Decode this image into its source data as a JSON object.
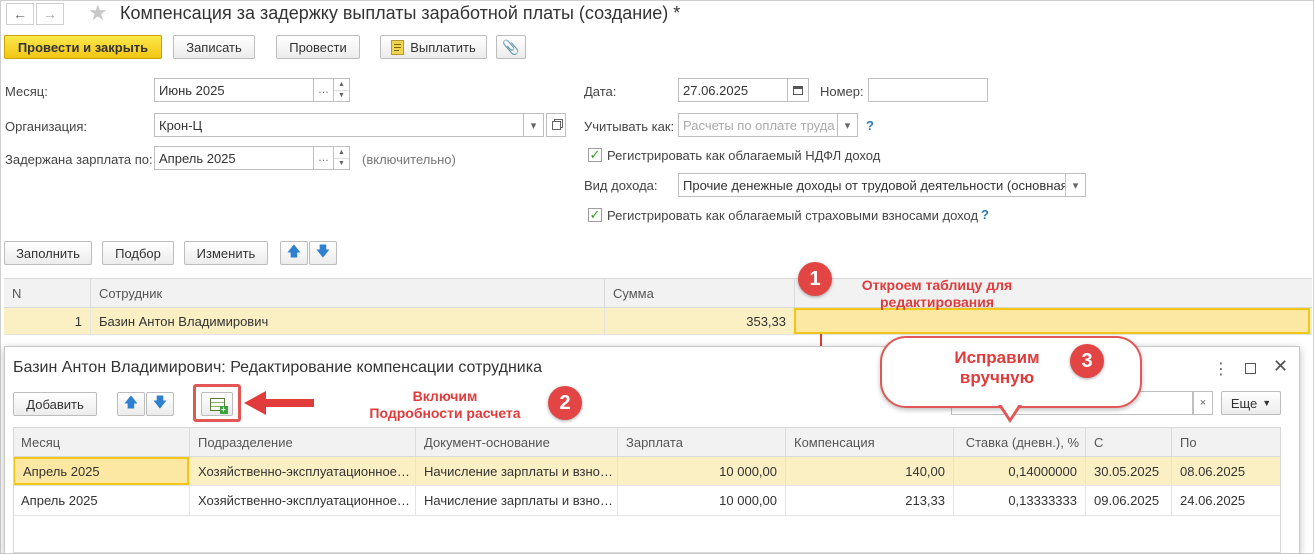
{
  "window": {
    "title": "Компенсация за задержку выплаты заработной платы (создание) *"
  },
  "toolbar": {
    "post_close": "Провести и закрыть",
    "save": "Записать",
    "post": "Провести",
    "pay": "Выплатить"
  },
  "form": {
    "month_label": "Месяц:",
    "month_value": "Июнь 2025",
    "org_label": "Организация:",
    "org_value": "Крон-Ц",
    "delayed_label": "Задержана зарплата по:",
    "delayed_value": "Апрель 2025",
    "delayed_note": "(включительно)",
    "date_label": "Дата:",
    "date_value": "27.06.2025",
    "number_label": "Номер:",
    "number_value": "",
    "account_label": "Учитывать как:",
    "account_placeholder": "Расчеты по оплате труда",
    "ndfl_label": "Регистрировать как облагаемый НДФЛ доход",
    "income_label": "Вид дохода:",
    "income_value": "Прочие денежные доходы от трудовой деятельности (основная",
    "insurance_label": "Регистрировать как облагаемый страховыми взносами доход",
    "help": "?"
  },
  "table_toolbar": {
    "fill": "Заполнить",
    "pick": "Подбор",
    "edit": "Изменить"
  },
  "main_table": {
    "headers": [
      "N",
      "Сотрудник",
      "Сумма"
    ],
    "rows": [
      {
        "n": "1",
        "employee": "Базин Антон Владимирович",
        "sum": "353,33"
      }
    ]
  },
  "dialog": {
    "title": "Базин Антон Владимирович: Редактирование компенсации сотрудника",
    "add": "Добавить",
    "more": "Еще",
    "headers": [
      "Месяц",
      "Подразделение",
      "Документ-основание",
      "Зарплата",
      "Компенсация",
      "Ставка (дневн.), %",
      "С",
      "По"
    ],
    "rows": [
      {
        "month": "Апрель 2025",
        "dept": "Хозяйственно-эксплуатационное…",
        "doc": "Начисление зарплаты и взно…",
        "salary": "10 000,00",
        "comp": "140,00",
        "rate": "0,14000000",
        "from": "30.05.2025",
        "to": "08.06.2025"
      },
      {
        "month": "Апрель 2025",
        "dept": "Хозяйственно-эксплуатационное…",
        "doc": "Начисление зарплаты и взно…",
        "salary": "10 000,00",
        "comp": "213,33",
        "rate": "0,13333333",
        "from": "09.06.2025",
        "to": "24.06.2025"
      }
    ]
  },
  "annotations": {
    "badge1": "1",
    "badge2": "2",
    "badge3": "3",
    "text1_line1": "Откроем таблицу для",
    "text1_line2": "редактирования",
    "text2_line1": "Включим",
    "text2_line2": "Подробности расчета",
    "text3_line1": "Исправим",
    "text3_line2": "вручную"
  },
  "colors": {
    "primary_button": "#f2c614",
    "selected_row": "#fbefc4",
    "annotation_red": "#e23b3b",
    "help_blue": "#2c7ab8"
  }
}
